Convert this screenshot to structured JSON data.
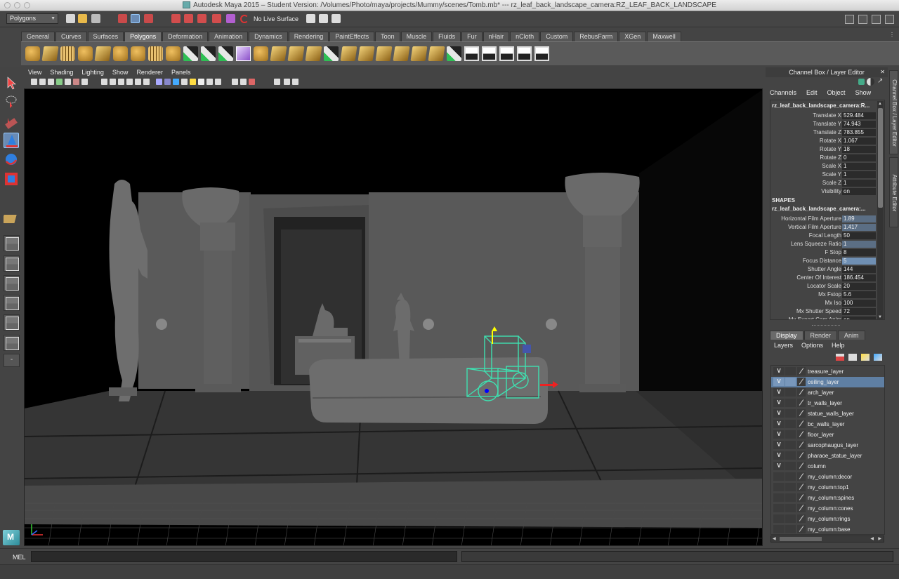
{
  "window": {
    "title": "Autodesk Maya 2015 – Student Version: /Volumes/Photo/maya/projects/Mummy/scenes/Tomb.mb*   ---   rz_leaf_back_landscape_camera:RZ_LEAF_BACK_LANDSCAPE"
  },
  "statusline": {
    "menuset": "Polygons",
    "live_surface": "No Live Surface"
  },
  "shelf": {
    "tabs": [
      "General",
      "Curves",
      "Surfaces",
      "Polygons",
      "Deformation",
      "Animation",
      "Dynamics",
      "Rendering",
      "PaintEffects",
      "Toon",
      "Muscle",
      "Fluids",
      "Fur",
      "nHair",
      "nCloth",
      "Custom",
      "RebusFarm",
      "XGen",
      "Maxwell"
    ],
    "active_tab": "Polygons"
  },
  "panel": {
    "menus": [
      "View",
      "Shading",
      "Lighting",
      "Show",
      "Renderer",
      "Panels"
    ]
  },
  "channel_box": {
    "title": "Channel Box / Layer Editor",
    "menus": [
      "Channels",
      "Edit",
      "Object",
      "Show"
    ],
    "node": "rz_leaf_back_landscape_camera:R...",
    "attributes": [
      {
        "label": "Translate X",
        "value": "529.484"
      },
      {
        "label": "Translate Y",
        "value": "74.943"
      },
      {
        "label": "Translate Z",
        "value": "783.855"
      },
      {
        "label": "Rotate X",
        "value": "1.067"
      },
      {
        "label": "Rotate Y",
        "value": "18"
      },
      {
        "label": "Rotate Z",
        "value": "0"
      },
      {
        "label": "Scale X",
        "value": "1"
      },
      {
        "label": "Scale Y",
        "value": "1"
      },
      {
        "label": "Scale Z",
        "value": "1"
      },
      {
        "label": "Visibility",
        "value": "on"
      }
    ],
    "shapes_label": "SHAPES",
    "shape_node": "rz_leaf_back_landscape_camera:...",
    "shape_attributes": [
      {
        "label": "Horizontal Film Aperture",
        "value": "1.89",
        "hl": true
      },
      {
        "label": "Vertical Film Aperture",
        "value": "1.417",
        "hl": true
      },
      {
        "label": "Focal Length",
        "value": "50",
        "hl": false
      },
      {
        "label": "Lens Squeeze Ratio",
        "value": "1",
        "hl": true
      },
      {
        "label": "F Stop",
        "value": "8",
        "hl": false
      },
      {
        "label": "Focus Distance",
        "value": "5",
        "hl": true
      },
      {
        "label": "Shutter Angle",
        "value": "144",
        "hl": false
      },
      {
        "label": "Center Of Interest",
        "value": "186.454",
        "hl": false
      },
      {
        "label": "Locator Scale",
        "value": "20",
        "hl": false
      },
      {
        "label": "Mx Fstop",
        "value": "5.6",
        "hl": false
      },
      {
        "label": "Mx Iso",
        "value": "100",
        "hl": false
      },
      {
        "label": "Mx Shutter Speed",
        "value": "72",
        "hl": false
      },
      {
        "label": "Mx Export Cam Anim",
        "value": "on",
        "hl": false
      }
    ]
  },
  "side_tabs": {
    "channel_box_tab": "Channel Box / Layer Editor",
    "attribute_editor_tab": "Attribute Editor"
  },
  "layer_editor": {
    "tabs": [
      "Display",
      "Render",
      "Anim"
    ],
    "active_tab": "Display",
    "menus": [
      "Layers",
      "Options",
      "Help"
    ],
    "layers": [
      {
        "v": "V",
        "name": "treasure_layer",
        "selected": false
      },
      {
        "v": "V",
        "name": "ceiling_layer",
        "selected": true
      },
      {
        "v": "V",
        "name": "arch_layer",
        "selected": false
      },
      {
        "v": "V",
        "name": "tr_walls_layer",
        "selected": false
      },
      {
        "v": "V",
        "name": "statue_walls_layer",
        "selected": false
      },
      {
        "v": "V",
        "name": "bc_walls_layer",
        "selected": false
      },
      {
        "v": "V",
        "name": "floor_layer",
        "selected": false
      },
      {
        "v": "V",
        "name": "sarcophaugus_layer",
        "selected": false
      },
      {
        "v": "V",
        "name": "pharaoe_statue_layer",
        "selected": false
      },
      {
        "v": "V",
        "name": "column",
        "selected": false
      },
      {
        "v": "",
        "name": "my_column:decor",
        "selected": false
      },
      {
        "v": "",
        "name": "my_column:top1",
        "selected": false
      },
      {
        "v": "",
        "name": "my_column:spines",
        "selected": false
      },
      {
        "v": "",
        "name": "my_column:cones",
        "selected": false
      },
      {
        "v": "",
        "name": "my_column:rings",
        "selected": false
      },
      {
        "v": "",
        "name": "my_column:base",
        "selected": false
      }
    ]
  },
  "command_line": {
    "label": "MEL"
  },
  "colors": {
    "accent": "#5f7fa3",
    "camera_wire": "#3fe0b0",
    "ui_bg": "#444444"
  }
}
